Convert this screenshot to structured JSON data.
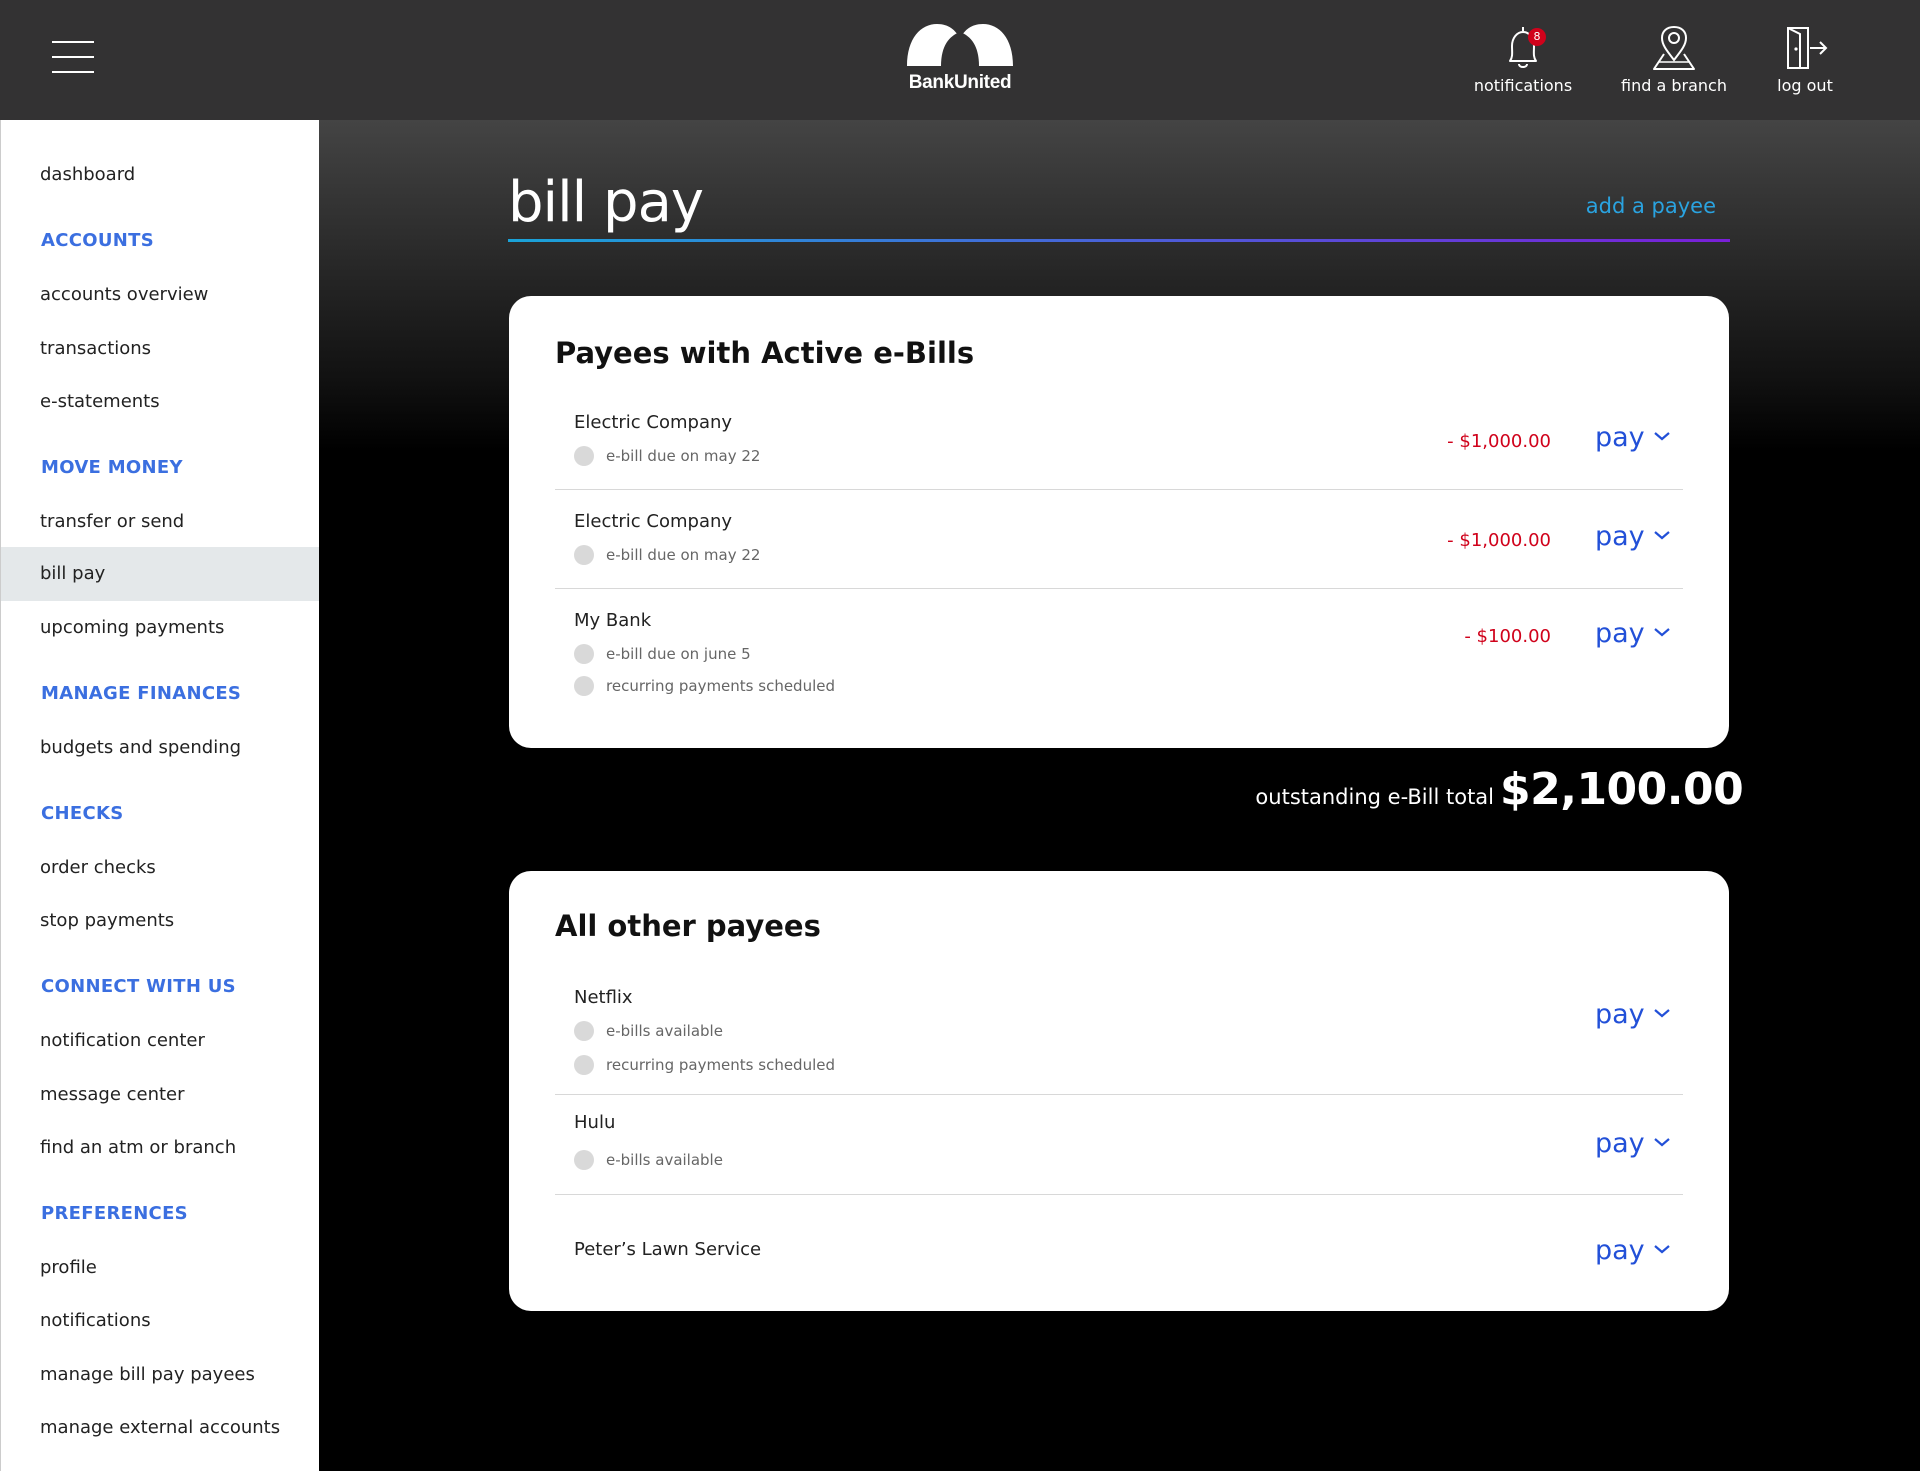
{
  "header": {
    "brand": "BankUnited",
    "notifications_label": "notifications",
    "notifications_count": "8",
    "find_branch_label": "find a branch",
    "logout_label": "log out"
  },
  "sidebar": {
    "dashboard": "dashboard",
    "sections": {
      "accounts": "ACCOUNTS",
      "move_money": "MOVE MONEY",
      "manage_finances": "MANAGE FINANCES",
      "checks": "CHECKS",
      "connect": "CONNECT WITH US",
      "preferences": "PREFERENCES"
    },
    "links": {
      "accounts_overview": "accounts overview",
      "transactions": "transactions",
      "e_statements": "e-statements",
      "transfer_or_send": "transfer or send",
      "bill_pay": "bill pay",
      "upcoming_payments": "upcoming payments",
      "budgets_and_spending": "budgets and spending",
      "order_checks": "order checks",
      "stop_payments": "stop payments",
      "notification_center": "notification center",
      "message_center": "message center",
      "find_atm_or_branch": "find an atm or branch",
      "profile": "profile",
      "notifications": "notifications",
      "manage_bill_pay_payees": "manage bill pay payees",
      "manage_external_accounts": "manage external accounts"
    },
    "active": "bill pay"
  },
  "main": {
    "title": "bill pay",
    "add_payee": "add a payee",
    "pay_label": "pay",
    "active_ebills": {
      "title": "Payees with Active e-Bills",
      "rows": [
        {
          "name": "Electric Company",
          "details": [
            "e-bill due on may 22"
          ],
          "amount": "- $1,000.00"
        },
        {
          "name": "Electric Company",
          "details": [
            "e-bill due on may 22"
          ],
          "amount": "- $1,000.00"
        },
        {
          "name": "My Bank",
          "details": [
            "e-bill due on june 5",
            "recurring payments scheduled"
          ],
          "amount": "- $100.00"
        }
      ]
    },
    "total": {
      "label": "outstanding e-Bill total",
      "value": "$2,100.00"
    },
    "other_payees": {
      "title": "All other payees",
      "rows": [
        {
          "name": "Netflix",
          "details": [
            "e-bills available",
            "recurring payments scheduled"
          ]
        },
        {
          "name": "Hulu",
          "details": [
            "e-bills available"
          ]
        },
        {
          "name": "Peter’s Lawn Service",
          "details": []
        }
      ]
    }
  },
  "colors": {
    "header_bg": "#333233",
    "section_heading": "#3b6fe0",
    "amount_negative": "#d0021b",
    "pay_link": "#2250d8",
    "add_payee_link": "#2aa3e0",
    "active_nav_bg": "#e4e8ea"
  }
}
